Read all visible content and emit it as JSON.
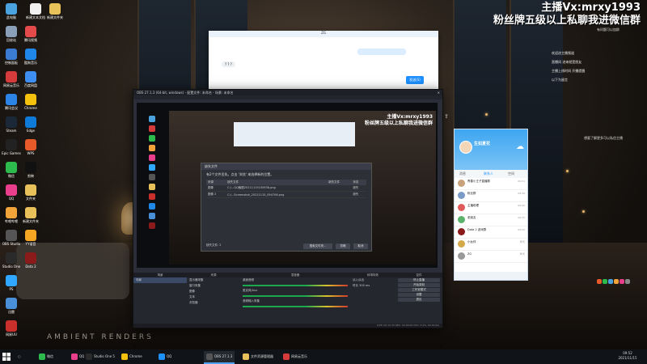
{
  "overlay": {
    "title": "主播Vx:mrxy1993",
    "subtitle": "粉丝牌五级以上私聊我进微信群",
    "note_top": "有问题可以加群",
    "notes": [
      "欢迎进主播频道",
      "直播间 进来就是朋友",
      "主播上线时间 开播提醒",
      "以下为留言"
    ],
    "note_bottom": "想要了解更多可以私信主播"
  },
  "desktop": {
    "icons": [
      "此电脑",
      "回收站",
      "控制面板",
      "网易云音乐",
      "腾讯会议",
      "Steam",
      "Epic Games",
      "微信",
      "QQ",
      "哔哩哔哩",
      "OBS Studio",
      "Studio One",
      "PS",
      "迅雷",
      "网易UU",
      "腾讯视频",
      "酷狗音乐",
      "百度网盘",
      "Chrome",
      "Edge",
      "WPS",
      "剪映",
      "文件夹",
      "新建文件夹",
      "YY语音",
      "Dota 2"
    ],
    "top_files": [
      "新建文本文档",
      "新建文件夹"
    ],
    "ambient": "AMBIENT RENDERS"
  },
  "chat_window": {
    "title": "ZG",
    "bubble_left": "? ? ?",
    "send_label": "发送(S)"
  },
  "obs": {
    "title": "OBS 27.1.3 (64-bit, windows) - 配置文件: 未命名 - 场景: 未命名",
    "docks": {
      "scenes": "场景",
      "sources": "来源",
      "mixer": "混音器",
      "transitions": "转场特效",
      "controls": "控件"
    },
    "scene_item": "场景",
    "source_items": [
      "显示器采集",
      "窗口采集",
      "图像",
      "文本",
      "浏览器"
    ],
    "mixer_items": [
      "桌面音频",
      "麦克风/Aux",
      "音频输入采集"
    ],
    "transition_label": "淡入淡出",
    "duration_label": "时长",
    "duration_value": "300 ms",
    "control_buttons": [
      "停止直播",
      "开始录制",
      "工作室模式",
      "设置",
      "退出"
    ],
    "status": "LIVE: 00:12:35   REC: 00:00:00   CPU: 3.2%, 60.00 fps"
  },
  "dialog": {
    "title": "缺失文件",
    "message": "有2个文件丢失。点击 '浏览' 来选择新的位置。",
    "columns": [
      "来源",
      "缺失文件",
      "新的文件",
      "状态"
    ],
    "rows": [
      {
        "source": "图像",
        "missing": "C:/...QQ截图20211115100938.png",
        "status": "缺失"
      },
      {
        "source": "图像 2",
        "missing": "C:/...Screenshot_20211115_094706.png",
        "status": "缺失"
      }
    ],
    "footer": "缺失文件: 2",
    "buttons": [
      "搜索文件夹...",
      "忽略",
      "取消"
    ]
  },
  "qq": {
    "nickname": "生如夏花",
    "tabs": [
      "消息",
      "联系人",
      "空间"
    ],
    "items": [
      {
        "name": "青春小王子直播群",
        "time": "09:51"
      },
      {
        "name": "粉丝群",
        "time": "09:48"
      },
      {
        "name": "主播助理",
        "time": "09:40"
      },
      {
        "name": "老朋友",
        "time": "09:35"
      },
      {
        "name": "Dota 2 游戏群",
        "time": "09:20"
      },
      {
        "name": "小伙伴",
        "time": "昨天"
      },
      {
        "name": "ZG",
        "time": "昨天"
      }
    ]
  },
  "taskbar": {
    "items": [
      "微信",
      "QQ",
      "Studio One 5",
      "Chrome",
      "QQ",
      "OBS 27.1.3",
      "文件资源管理器",
      "网易云音乐"
    ],
    "time": "09:52",
    "date": "2021/11/15"
  },
  "colors": {
    "obs_bg": "#2b2e38",
    "accent_blue": "#1e90ff",
    "qq_header": "#3ea6f0"
  }
}
